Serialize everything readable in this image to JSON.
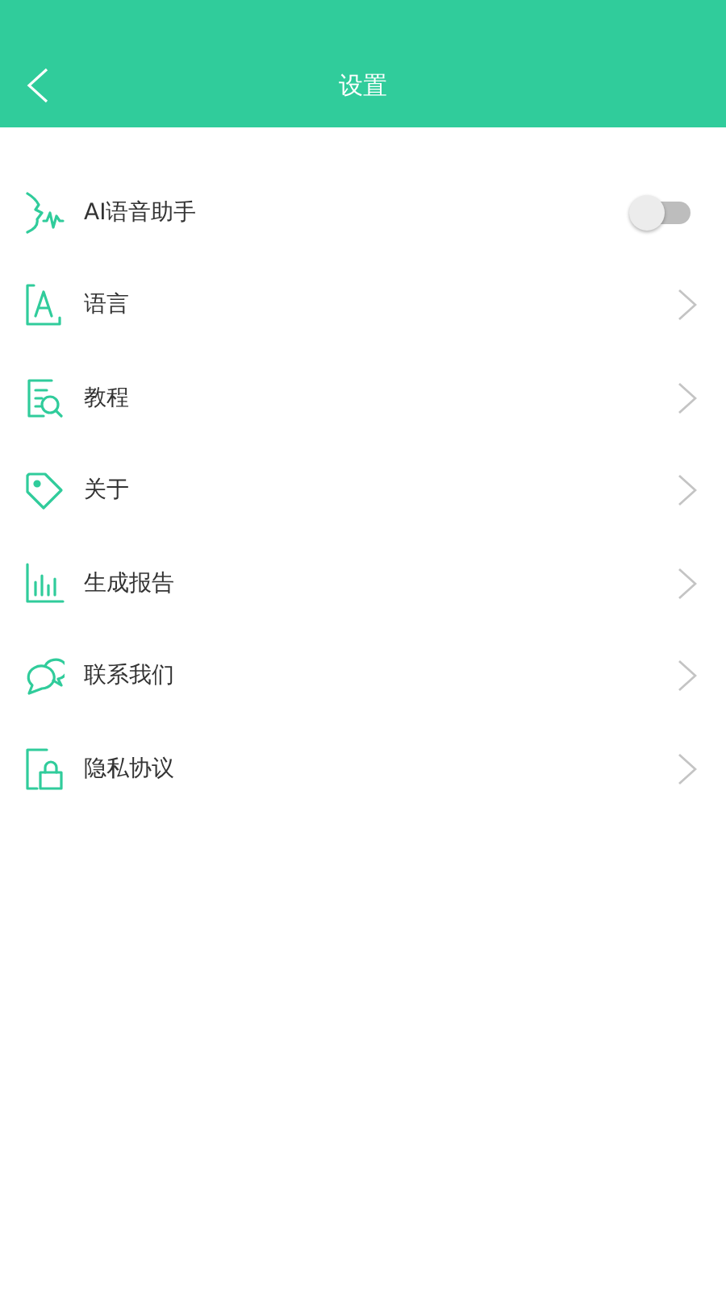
{
  "header": {
    "title": "设置"
  },
  "items": [
    {
      "kind": "toggle",
      "label": "AI语音助手",
      "on": false
    },
    {
      "kind": "link",
      "label": "语言"
    },
    {
      "kind": "link",
      "label": "教程"
    },
    {
      "kind": "link",
      "label": "关于"
    },
    {
      "kind": "link",
      "label": "生成报告"
    },
    {
      "kind": "link",
      "label": "联系我们"
    },
    {
      "kind": "link",
      "label": "隐私协议"
    }
  ]
}
